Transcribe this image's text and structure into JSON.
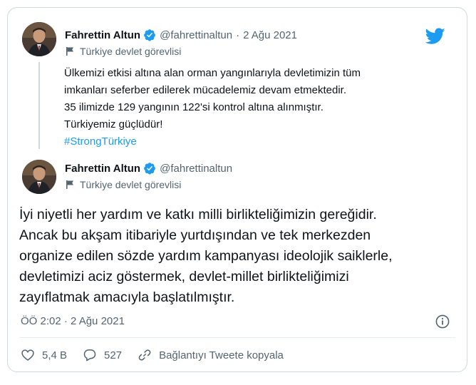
{
  "quoted_tweet": {
    "author_name": "Fahrettin Altun",
    "handle": "@fahrettinaltun",
    "separator": "·",
    "date": "2 Ağu 2021",
    "label": "Türkiye devlet görevlisi",
    "lines": [
      "Ülkemizi etkisi altına alan orman yangınlarıyla devletimizin tüm",
      "imkanları seferber edilerek mücadelemiz devam etmektedir.",
      "35 ilimizde 129 yangının 122'si kontrol altına alınmıştır.",
      "Türkiyemiz güçlüdür!"
    ],
    "hashtag": "#StrongTürkiye"
  },
  "main_tweet": {
    "author_name": "Fahrettin Altun",
    "handle": "@fahrettinaltun",
    "label": "Türkiye devlet görevlisi",
    "lines": [
      "İyi niyetli her yardım ve katkı milli birlikteliğimizin gereğidir.",
      "Ancak bu akşam itibariyle yurtdışından ve tek merkezden",
      "organize edilen sözde yardım kampanyası ideolojik saiklerle,",
      "devletimizi aciz göstermek, devlet-millet birlikteliğimizi",
      "zayıflatmak amacıyla başlatılmıştır."
    ],
    "timestamp": "ÖÖ 2:02 · 2 Ağu 2021"
  },
  "actions": {
    "likes": "5,4 B",
    "replies": "527",
    "copy_link": "Bağlantıyı Tweete kopyala"
  },
  "colors": {
    "link_blue": "#1d9bf0",
    "muted_text": "#536471",
    "border": "#cfd9de"
  },
  "icons": [
    "twitter-logo",
    "verified-badge-icon",
    "flag-icon",
    "info-icon",
    "heart-icon",
    "reply-icon",
    "link-icon"
  ]
}
